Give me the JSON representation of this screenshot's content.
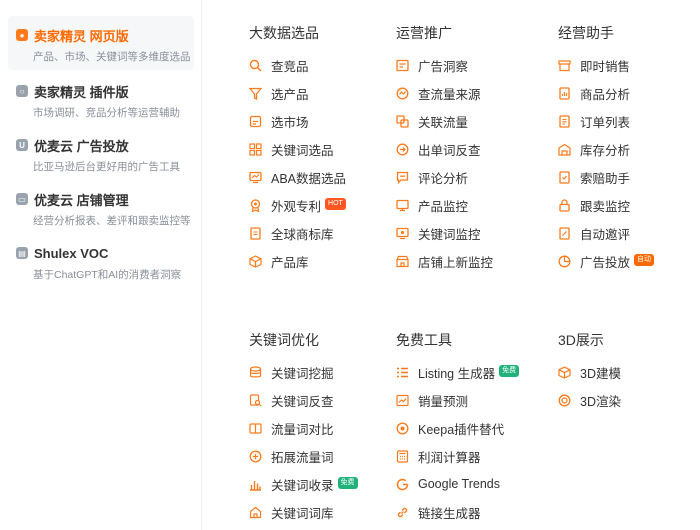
{
  "sidebar": {
    "items": [
      {
        "title": "卖家精灵 网页版",
        "sub": "产品、市场、关键词等多维度选品",
        "active": true
      },
      {
        "title": "卖家精灵 插件版",
        "sub": "市场调研、竞品分析等运营辅助"
      },
      {
        "title": "优麦云 广告投放",
        "sub": "比亚马逊后台更好用的广告工具"
      },
      {
        "title": "优麦云 店铺管理",
        "sub": "经营分析报表、差评和跟卖监控等"
      },
      {
        "title": "Shulex VOC",
        "sub": "基于ChatGPT和AI的消费者洞察"
      }
    ]
  },
  "columns": {
    "big_data": {
      "title": "大数据选品",
      "links": [
        "查竞品",
        "选产品",
        "选市场",
        "关键词选品",
        "ABA数据选品",
        "外观专利",
        "全球商标库",
        "产品库"
      ],
      "hot_badge": "HOT"
    },
    "promotion": {
      "title": "运营推广",
      "links": [
        "广告洞察",
        "查流量来源",
        "关联流量",
        "出单词反查",
        "评论分析",
        "产品监控",
        "关键词监控",
        "店铺上新监控"
      ]
    },
    "assistant": {
      "title": "经营助手",
      "links": [
        "即时销售",
        "商品分析",
        "订单列表",
        "库存分析",
        "索赔助手",
        "跟卖监控",
        "自动邀评",
        "广告投放"
      ],
      "auto_badge": "自动"
    },
    "keyword_opt": {
      "title": "关键词优化",
      "links": [
        "关键词挖掘",
        "关键词反查",
        "流量词对比",
        "拓展流量词",
        "关键词收录",
        "关键词词库"
      ],
      "free_badge": "免费"
    },
    "free_tools": {
      "title": "免费工具",
      "links": [
        "Listing 生成器",
        "销量预测",
        "Keepa插件替代",
        "利润计算器",
        "Google Trends",
        "链接生成器"
      ],
      "free_badge": "免费"
    },
    "show3d": {
      "title": "3D展示",
      "links": [
        "3D建模",
        "3D渲染"
      ]
    }
  },
  "colors": {
    "accent": "#ff6a00",
    "icon": "#ff7a1a",
    "hot": "#ff5722",
    "free": "#21b27a"
  }
}
